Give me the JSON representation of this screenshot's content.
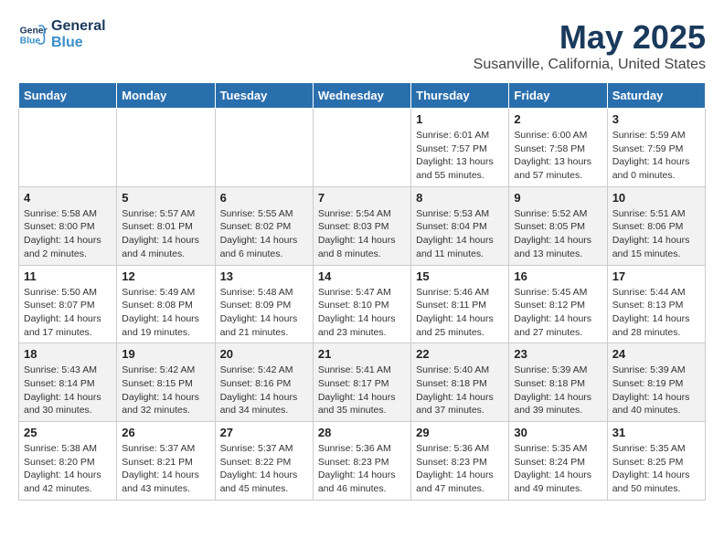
{
  "header": {
    "logo_line1": "General",
    "logo_line2": "Blue",
    "title": "May 2025",
    "subtitle": "Susanville, California, United States"
  },
  "days_of_week": [
    "Sunday",
    "Monday",
    "Tuesday",
    "Wednesday",
    "Thursday",
    "Friday",
    "Saturday"
  ],
  "weeks": [
    [
      {
        "day": "",
        "info": ""
      },
      {
        "day": "",
        "info": ""
      },
      {
        "day": "",
        "info": ""
      },
      {
        "day": "",
        "info": ""
      },
      {
        "day": "1",
        "info": "Sunrise: 6:01 AM\nSunset: 7:57 PM\nDaylight: 13 hours\nand 55 minutes."
      },
      {
        "day": "2",
        "info": "Sunrise: 6:00 AM\nSunset: 7:58 PM\nDaylight: 13 hours\nand 57 minutes."
      },
      {
        "day": "3",
        "info": "Sunrise: 5:59 AM\nSunset: 7:59 PM\nDaylight: 14 hours\nand 0 minutes."
      }
    ],
    [
      {
        "day": "4",
        "info": "Sunrise: 5:58 AM\nSunset: 8:00 PM\nDaylight: 14 hours\nand 2 minutes."
      },
      {
        "day": "5",
        "info": "Sunrise: 5:57 AM\nSunset: 8:01 PM\nDaylight: 14 hours\nand 4 minutes."
      },
      {
        "day": "6",
        "info": "Sunrise: 5:55 AM\nSunset: 8:02 PM\nDaylight: 14 hours\nand 6 minutes."
      },
      {
        "day": "7",
        "info": "Sunrise: 5:54 AM\nSunset: 8:03 PM\nDaylight: 14 hours\nand 8 minutes."
      },
      {
        "day": "8",
        "info": "Sunrise: 5:53 AM\nSunset: 8:04 PM\nDaylight: 14 hours\nand 11 minutes."
      },
      {
        "day": "9",
        "info": "Sunrise: 5:52 AM\nSunset: 8:05 PM\nDaylight: 14 hours\nand 13 minutes."
      },
      {
        "day": "10",
        "info": "Sunrise: 5:51 AM\nSunset: 8:06 PM\nDaylight: 14 hours\nand 15 minutes."
      }
    ],
    [
      {
        "day": "11",
        "info": "Sunrise: 5:50 AM\nSunset: 8:07 PM\nDaylight: 14 hours\nand 17 minutes."
      },
      {
        "day": "12",
        "info": "Sunrise: 5:49 AM\nSunset: 8:08 PM\nDaylight: 14 hours\nand 19 minutes."
      },
      {
        "day": "13",
        "info": "Sunrise: 5:48 AM\nSunset: 8:09 PM\nDaylight: 14 hours\nand 21 minutes."
      },
      {
        "day": "14",
        "info": "Sunrise: 5:47 AM\nSunset: 8:10 PM\nDaylight: 14 hours\nand 23 minutes."
      },
      {
        "day": "15",
        "info": "Sunrise: 5:46 AM\nSunset: 8:11 PM\nDaylight: 14 hours\nand 25 minutes."
      },
      {
        "day": "16",
        "info": "Sunrise: 5:45 AM\nSunset: 8:12 PM\nDaylight: 14 hours\nand 27 minutes."
      },
      {
        "day": "17",
        "info": "Sunrise: 5:44 AM\nSunset: 8:13 PM\nDaylight: 14 hours\nand 28 minutes."
      }
    ],
    [
      {
        "day": "18",
        "info": "Sunrise: 5:43 AM\nSunset: 8:14 PM\nDaylight: 14 hours\nand 30 minutes."
      },
      {
        "day": "19",
        "info": "Sunrise: 5:42 AM\nSunset: 8:15 PM\nDaylight: 14 hours\nand 32 minutes."
      },
      {
        "day": "20",
        "info": "Sunrise: 5:42 AM\nSunset: 8:16 PM\nDaylight: 14 hours\nand 34 minutes."
      },
      {
        "day": "21",
        "info": "Sunrise: 5:41 AM\nSunset: 8:17 PM\nDaylight: 14 hours\nand 35 minutes."
      },
      {
        "day": "22",
        "info": "Sunrise: 5:40 AM\nSunset: 8:18 PM\nDaylight: 14 hours\nand 37 minutes."
      },
      {
        "day": "23",
        "info": "Sunrise: 5:39 AM\nSunset: 8:18 PM\nDaylight: 14 hours\nand 39 minutes."
      },
      {
        "day": "24",
        "info": "Sunrise: 5:39 AM\nSunset: 8:19 PM\nDaylight: 14 hours\nand 40 minutes."
      }
    ],
    [
      {
        "day": "25",
        "info": "Sunrise: 5:38 AM\nSunset: 8:20 PM\nDaylight: 14 hours\nand 42 minutes."
      },
      {
        "day": "26",
        "info": "Sunrise: 5:37 AM\nSunset: 8:21 PM\nDaylight: 14 hours\nand 43 minutes."
      },
      {
        "day": "27",
        "info": "Sunrise: 5:37 AM\nSunset: 8:22 PM\nDaylight: 14 hours\nand 45 minutes."
      },
      {
        "day": "28",
        "info": "Sunrise: 5:36 AM\nSunset: 8:23 PM\nDaylight: 14 hours\nand 46 minutes."
      },
      {
        "day": "29",
        "info": "Sunrise: 5:36 AM\nSunset: 8:23 PM\nDaylight: 14 hours\nand 47 minutes."
      },
      {
        "day": "30",
        "info": "Sunrise: 5:35 AM\nSunset: 8:24 PM\nDaylight: 14 hours\nand 49 minutes."
      },
      {
        "day": "31",
        "info": "Sunrise: 5:35 AM\nSunset: 8:25 PM\nDaylight: 14 hours\nand 50 minutes."
      }
    ]
  ]
}
